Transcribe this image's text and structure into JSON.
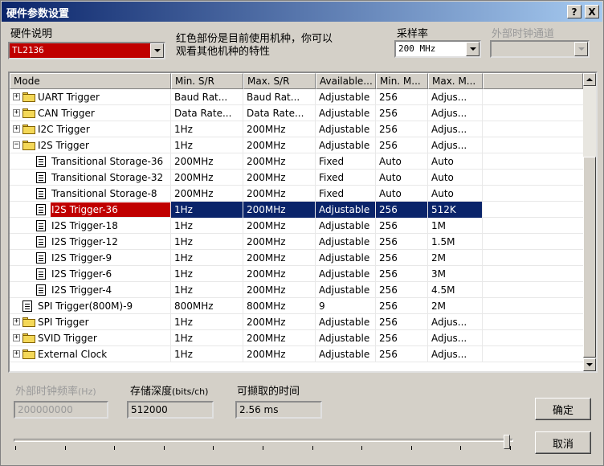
{
  "window": {
    "title": "硬件参数设置",
    "help_label": "?",
    "close_label": "X"
  },
  "hardware": {
    "label": "硬件说明",
    "value": "TL2136",
    "accent": "#c00000"
  },
  "note": {
    "line1": "红色部份是目前使用机种，你可以",
    "line2": "观看其他机种的特性"
  },
  "sample_rate": {
    "label": "采样率",
    "value": "200 MHz"
  },
  "ext_clock_channel": {
    "label": "外部时钟通道",
    "value": ""
  },
  "table": {
    "columns": [
      "Mode",
      "Min. S/R",
      "Max. S/R",
      "Available...",
      "Min. M...",
      "Max. M..."
    ],
    "rows": [
      {
        "expander": "+",
        "icon": "folder-icon",
        "indent": 0,
        "mode": "UART Trigger",
        "min_sr": "Baud Rat...",
        "max_sr": "Baud Rat...",
        "available": "Adjustable",
        "min_m": "256",
        "max_m": "Adjus..."
      },
      {
        "expander": "+",
        "icon": "folder-icon",
        "indent": 0,
        "mode": "CAN Trigger",
        "min_sr": "Data Rate...",
        "max_sr": "Data Rate...",
        "available": "Adjustable",
        "min_m": "256",
        "max_m": "Adjus..."
      },
      {
        "expander": "+",
        "icon": "folder-icon",
        "indent": 0,
        "mode": "I2C Trigger",
        "min_sr": "1Hz",
        "max_sr": "200MHz",
        "available": "Adjustable",
        "min_m": "256",
        "max_m": "Adjus..."
      },
      {
        "expander": "−",
        "icon": "folder-icon",
        "indent": 0,
        "mode": "I2S Trigger",
        "min_sr": "1Hz",
        "max_sr": "200MHz",
        "available": "Adjustable",
        "min_m": "256",
        "max_m": "Adjus..."
      },
      {
        "expander": "",
        "icon": "doc-icon",
        "indent": 1,
        "mode": "Transitional Storage-36",
        "min_sr": "200MHz",
        "max_sr": "200MHz",
        "available": "Fixed",
        "min_m": "Auto",
        "max_m": "Auto"
      },
      {
        "expander": "",
        "icon": "doc-icon",
        "indent": 1,
        "mode": "Transitional Storage-32",
        "min_sr": "200MHz",
        "max_sr": "200MHz",
        "available": "Fixed",
        "min_m": "Auto",
        "max_m": "Auto"
      },
      {
        "expander": "",
        "icon": "doc-icon",
        "indent": 1,
        "mode": "Transitional Storage-8",
        "min_sr": "200MHz",
        "max_sr": "200MHz",
        "available": "Fixed",
        "min_m": "Auto",
        "max_m": "Auto"
      },
      {
        "expander": "",
        "icon": "doc-icon",
        "indent": 1,
        "mode": "I2S Trigger-36",
        "min_sr": "1Hz",
        "max_sr": "200MHz",
        "available": "Adjustable",
        "min_m": "256",
        "max_m": "512K",
        "selected": true
      },
      {
        "expander": "",
        "icon": "doc-icon",
        "indent": 1,
        "mode": "I2S Trigger-18",
        "min_sr": "1Hz",
        "max_sr": "200MHz",
        "available": "Adjustable",
        "min_m": "256",
        "max_m": "1M"
      },
      {
        "expander": "",
        "icon": "doc-icon",
        "indent": 1,
        "mode": "I2S Trigger-12",
        "min_sr": "1Hz",
        "max_sr": "200MHz",
        "available": "Adjustable",
        "min_m": "256",
        "max_m": "1.5M"
      },
      {
        "expander": "",
        "icon": "doc-icon",
        "indent": 1,
        "mode": "I2S Trigger-9",
        "min_sr": "1Hz",
        "max_sr": "200MHz",
        "available": "Adjustable",
        "min_m": "256",
        "max_m": "2M"
      },
      {
        "expander": "",
        "icon": "doc-icon",
        "indent": 1,
        "mode": "I2S Trigger-6",
        "min_sr": "1Hz",
        "max_sr": "200MHz",
        "available": "Adjustable",
        "min_m": "256",
        "max_m": "3M"
      },
      {
        "expander": "",
        "icon": "doc-icon",
        "indent": 1,
        "mode": "I2S Trigger-4",
        "min_sr": "1Hz",
        "max_sr": "200MHz",
        "available": "Adjustable",
        "min_m": "256",
        "max_m": "4.5M"
      },
      {
        "expander": "",
        "icon": "doc-icon",
        "indent": 0,
        "mode": "SPI Trigger(800M)-9",
        "min_sr": "800MHz",
        "max_sr": "800MHz",
        "available": "9",
        "min_m": "256",
        "max_m": "2M"
      },
      {
        "expander": "+",
        "icon": "folder-icon",
        "indent": 0,
        "mode": "SPI Trigger",
        "min_sr": "1Hz",
        "max_sr": "200MHz",
        "available": "Adjustable",
        "min_m": "256",
        "max_m": "Adjus..."
      },
      {
        "expander": "+",
        "icon": "folder-icon",
        "indent": 0,
        "mode": "SVID Trigger",
        "min_sr": "1Hz",
        "max_sr": "200MHz",
        "available": "Adjustable",
        "min_m": "256",
        "max_m": "Adjus..."
      },
      {
        "expander": "+",
        "icon": "folder-icon",
        "indent": 0,
        "mode": "External Clock",
        "min_sr": "1Hz",
        "max_sr": "200MHz",
        "available": "Adjustable",
        "min_m": "256",
        "max_m": "Adjus..."
      }
    ]
  },
  "ext_freq": {
    "label": "外部时钟频率",
    "unit": "(Hz)",
    "value": "200000000"
  },
  "depth": {
    "label": "存储深度",
    "unit": "(bits/ch)",
    "value": "512000"
  },
  "capture_time": {
    "label": "可撷取的时间",
    "value": "2.56 ms"
  },
  "buttons": {
    "ok": "确定",
    "cancel": "取消"
  },
  "slider": {
    "position": 1.0,
    "ticks": 10
  }
}
